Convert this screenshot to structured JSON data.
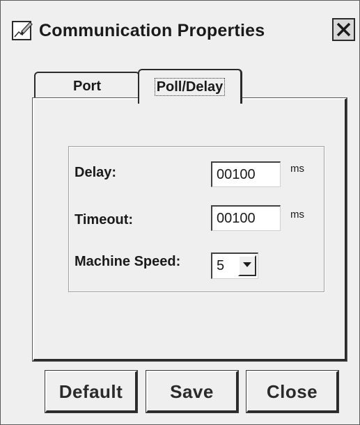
{
  "window": {
    "title": "Communication Properties",
    "icon": "pencil-chart-icon",
    "close_icon": "close-x-icon"
  },
  "tabs": [
    {
      "label": "Port",
      "selected": false
    },
    {
      "label": "Poll/Delay",
      "selected": true
    }
  ],
  "fields": {
    "delay": {
      "label": "Delay:",
      "value": "00100",
      "unit": "ms"
    },
    "timeout": {
      "label": "Timeout:",
      "value": "00100",
      "unit": "ms"
    },
    "machine_speed": {
      "label": "Machine Speed:",
      "value": "5",
      "arrow_icon": "chevron-down-icon"
    }
  },
  "buttons": {
    "default": "Default",
    "save": "Save",
    "close": "Close"
  }
}
